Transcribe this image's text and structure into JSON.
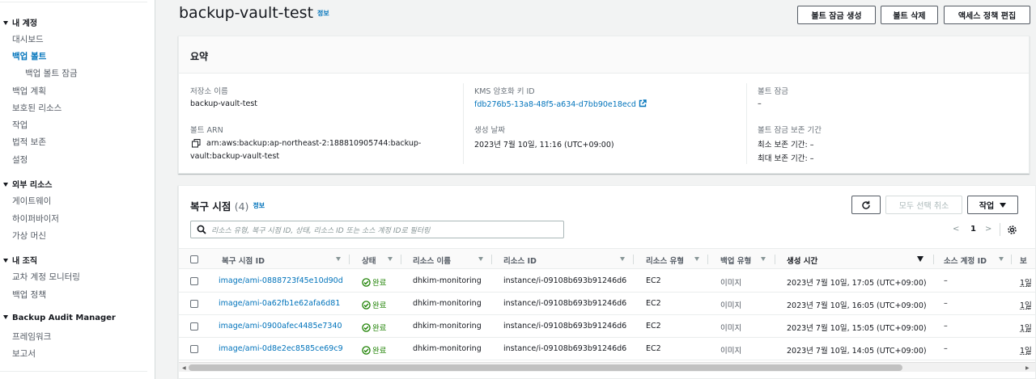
{
  "sidebar": {
    "sections": [
      {
        "label": "내 계정",
        "items": [
          {
            "label": "대시보드"
          },
          {
            "label": "백업 볼트"
          },
          {
            "label": "백업 볼트 잠금"
          },
          {
            "label": "백업 계획"
          },
          {
            "label": "보호된 리소스"
          },
          {
            "label": "작업"
          },
          {
            "label": "법적 보존"
          },
          {
            "label": "설정"
          }
        ]
      },
      {
        "label": "외부 리소스",
        "items": [
          {
            "label": "게이트웨이"
          },
          {
            "label": "하이퍼바이저"
          },
          {
            "label": "가상 머신"
          }
        ]
      },
      {
        "label": "내 조직",
        "items": [
          {
            "label": "교차 계정 모니터링"
          },
          {
            "label": "백업 정책"
          }
        ]
      },
      {
        "label": "Backup Audit Manager",
        "items": [
          {
            "label": "프레임워크"
          },
          {
            "label": "보고서"
          }
        ]
      }
    ],
    "active_item": "백업 볼트"
  },
  "header": {
    "title": "backup-vault-test",
    "info_label": "정보",
    "buttons": {
      "create_lock": "볼트 잠금 생성",
      "delete_vault": "볼트 삭제",
      "edit_policy": "액세스 정책 편집"
    }
  },
  "summary": {
    "title": "요약",
    "vault_name_label": "저장소 이름",
    "vault_name": "backup-vault-test",
    "arn_label": "볼트 ARN",
    "arn_line1": "arn:aws:backup:ap-northeast-2:188810905744:backup-",
    "arn_line2": "vault:backup-vault-test",
    "kms_label": "KMS 암호화 키 ID",
    "kms_value": "fdb276b5-13a8-48f5-a634-d7bb90e18ecd",
    "created_label": "생성 날짜",
    "created_value": "2023년 7월 10일, 11:16 (UTC+09:00)",
    "lock_label": "볼트 잠금",
    "lock_value": "–",
    "retention_label": "볼트 잠금 보존 기간",
    "min_retention": "최소 보존 기간: –",
    "max_retention": "최대 보존 기간: –"
  },
  "recovery": {
    "title": "복구 시점",
    "count": "(4)",
    "info_label": "정보",
    "refresh_icon": "refresh-icon",
    "deselect_label": "모두 선택 취소",
    "actions_label": "작업",
    "search_placeholder": "리소스 유형, 복구 시점 ID, 상태, 리소스 ID 또는 소스 계정 ID로 필터링",
    "page": "1",
    "columns": {
      "id": "복구 시점 ID",
      "status": "상태",
      "resource_name": "리소스 이름",
      "resource_id": "리소스 ID",
      "resource_type": "리소스 유형",
      "backup_type": "백업 유형",
      "created": "생성 시간",
      "source_account": "소스 계정 ID",
      "more": "보"
    },
    "rows": [
      {
        "id": "image/ami-0888723f45e10d90d",
        "status": "완료",
        "resource_name": "dhkim-monitoring",
        "resource_id": "instance/i-09108b693b91246d6",
        "resource_type": "EC2",
        "backup_type": "이미지",
        "created": "2023년 7월 10일, 17:05 (UTC+09:00)",
        "source_account": "–",
        "more": "1일"
      },
      {
        "id": "image/ami-0a62fb1e62afa6d81",
        "status": "완료",
        "resource_name": "dhkim-monitoring",
        "resource_id": "instance/i-09108b693b91246d6",
        "resource_type": "EC2",
        "backup_type": "이미지",
        "created": "2023년 7월 10일, 16:05 (UTC+09:00)",
        "source_account": "–",
        "more": "1일"
      },
      {
        "id": "image/ami-0900afec4485e7340",
        "status": "완료",
        "resource_name": "dhkim-monitoring",
        "resource_id": "instance/i-09108b693b91246d6",
        "resource_type": "EC2",
        "backup_type": "이미지",
        "created": "2023년 7월 10일, 15:05 (UTC+09:00)",
        "source_account": "–",
        "more": "1일"
      },
      {
        "id": "image/ami-0d8e2ec8585ce69c9",
        "status": "완료",
        "resource_name": "dhkim-monitoring",
        "resource_id": "instance/i-09108b693b91246d6",
        "resource_type": "EC2",
        "backup_type": "이미지",
        "created": "2023년 7월 10일, 14:05 (UTC+09:00)",
        "source_account": "–",
        "more": "1일"
      }
    ]
  },
  "colors": {
    "link": "#0073bb",
    "success": "#1d8102",
    "text": "#16191f",
    "muted": "#687078"
  }
}
